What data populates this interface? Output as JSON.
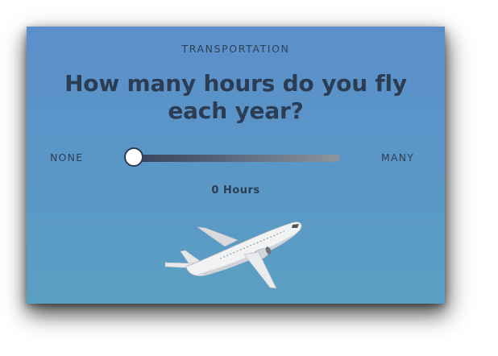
{
  "question_card": {
    "category": "TRANSPORTATION",
    "question": "How many hours do you fly each year?",
    "slider": {
      "min_label": "NONE",
      "max_label": "MANY",
      "value_fraction": 0.0
    },
    "value_text": "0 Hours",
    "illustration": "airplane-icon"
  },
  "colors": {
    "background_top": "#5b8fca",
    "background_bottom": "#5aa0c2",
    "text": "#2c3c52",
    "thumb": "#ffffff"
  }
}
